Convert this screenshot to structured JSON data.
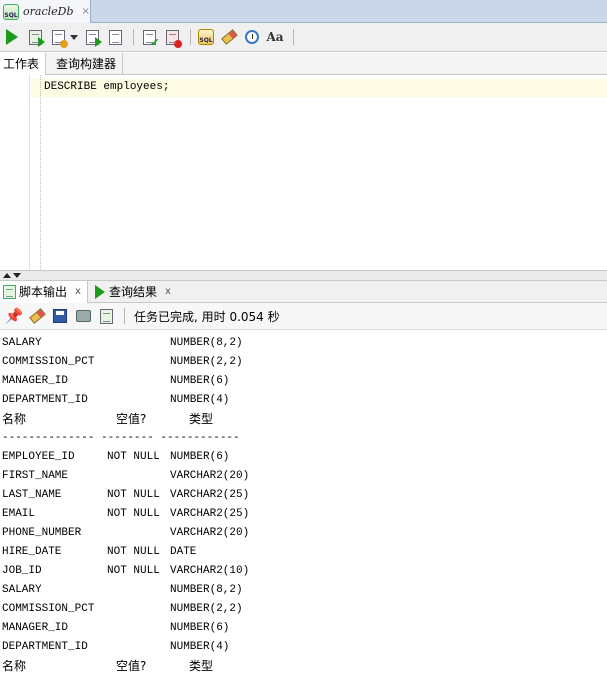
{
  "document_tab": {
    "label": "oracleDb",
    "close": "×",
    "icon_text": "SQL"
  },
  "toolbar": {
    "icons": [
      "run-statement-icon",
      "run-script-icon",
      "sql-history-icon",
      "commit-icon",
      "rollback-icon",
      "sql-tuning-icon",
      "clear-icon",
      "autotrace-icon",
      "to-upper-lower-icon"
    ],
    "aa_label": "Aa"
  },
  "subtabs": {
    "worksheet": "工作表",
    "query_builder": "查询构建器"
  },
  "editor": {
    "code": "DESCRIBE employees;"
  },
  "output_tabs": {
    "script_output": "脚本输出",
    "script_output_close": "x",
    "query_result": "查询结果",
    "query_result_close": "x"
  },
  "output_toolbar": {
    "status": "任务已完成, 用时 0.054 秒"
  },
  "output": {
    "header": {
      "name": "名称",
      "null": "空值?",
      "type": "类型"
    },
    "separator": "-------------- -------- ------------",
    "rows_partial": [
      {
        "name": "SALARY",
        "null": "",
        "type": "NUMBER(8,2)"
      },
      {
        "name": "COMMISSION_PCT",
        "null": "",
        "type": "NUMBER(2,2)"
      },
      {
        "name": "MANAGER_ID",
        "null": "",
        "type": "NUMBER(6)"
      },
      {
        "name": "DEPARTMENT_ID",
        "null": "",
        "type": "NUMBER(4)"
      }
    ],
    "rows": [
      {
        "name": "EMPLOYEE_ID",
        "null": "NOT NULL",
        "type": "NUMBER(6)"
      },
      {
        "name": "FIRST_NAME",
        "null": "",
        "type": "VARCHAR2(20)"
      },
      {
        "name": "LAST_NAME",
        "null": "NOT NULL",
        "type": "VARCHAR2(25)"
      },
      {
        "name": "EMAIL",
        "null": "NOT NULL",
        "type": "VARCHAR2(25)"
      },
      {
        "name": "PHONE_NUMBER",
        "null": "",
        "type": "VARCHAR2(20)"
      },
      {
        "name": "HIRE_DATE",
        "null": "NOT NULL",
        "type": "DATE"
      },
      {
        "name": "JOB_ID",
        "null": "NOT NULL",
        "type": "VARCHAR2(10)"
      },
      {
        "name": "SALARY",
        "null": "",
        "type": "NUMBER(8,2)"
      },
      {
        "name": "COMMISSION_PCT",
        "null": "",
        "type": "NUMBER(2,2)"
      },
      {
        "name": "MANAGER_ID",
        "null": "",
        "type": "NUMBER(6)"
      },
      {
        "name": "DEPARTMENT_ID",
        "null": "",
        "type": "NUMBER(4)"
      }
    ]
  }
}
